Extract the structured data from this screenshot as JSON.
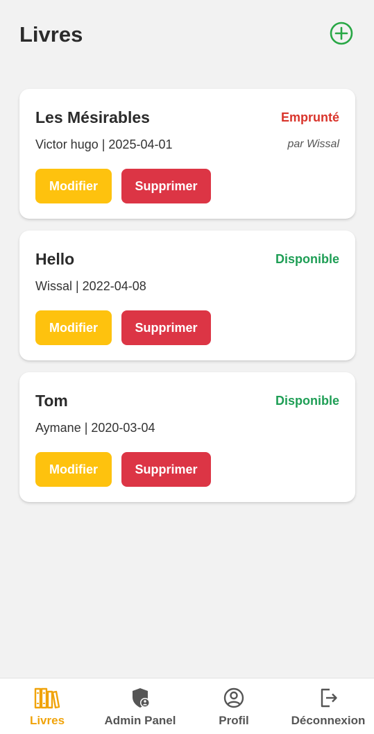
{
  "header": {
    "title": "Livres",
    "add_icon": "plus-circle-icon"
  },
  "colors": {
    "accent_green": "#28a745",
    "status_borrowed": "#d9342b",
    "status_available": "#1e9e55",
    "edit_button": "#fec20e",
    "delete_button": "#dc3545",
    "nav_active": "#f0a30a"
  },
  "books": [
    {
      "title": "Les Mésirables",
      "meta": "Victor hugo | 2025-04-01",
      "status": "Emprunté",
      "status_type": "borrowed",
      "borrower": "par Wissal",
      "edit_label": "Modifier",
      "delete_label": "Supprimer"
    },
    {
      "title": "Hello",
      "meta": "Wissal | 2022-04-08",
      "status": "Disponible",
      "status_type": "available",
      "borrower": "",
      "edit_label": "Modifier",
      "delete_label": "Supprimer"
    },
    {
      "title": "Tom",
      "meta": "Aymane | 2020-03-04",
      "status": "Disponible",
      "status_type": "available",
      "borrower": "",
      "edit_label": "Modifier",
      "delete_label": "Supprimer"
    }
  ],
  "nav": {
    "items": [
      {
        "label": "Livres",
        "icon": "books-icon",
        "active": true
      },
      {
        "label": "Admin Panel",
        "icon": "shield-user-icon",
        "active": false
      },
      {
        "label": "Profil",
        "icon": "user-circle-icon",
        "active": false
      },
      {
        "label": "Déconnexion",
        "icon": "logout-icon",
        "active": false
      }
    ]
  }
}
